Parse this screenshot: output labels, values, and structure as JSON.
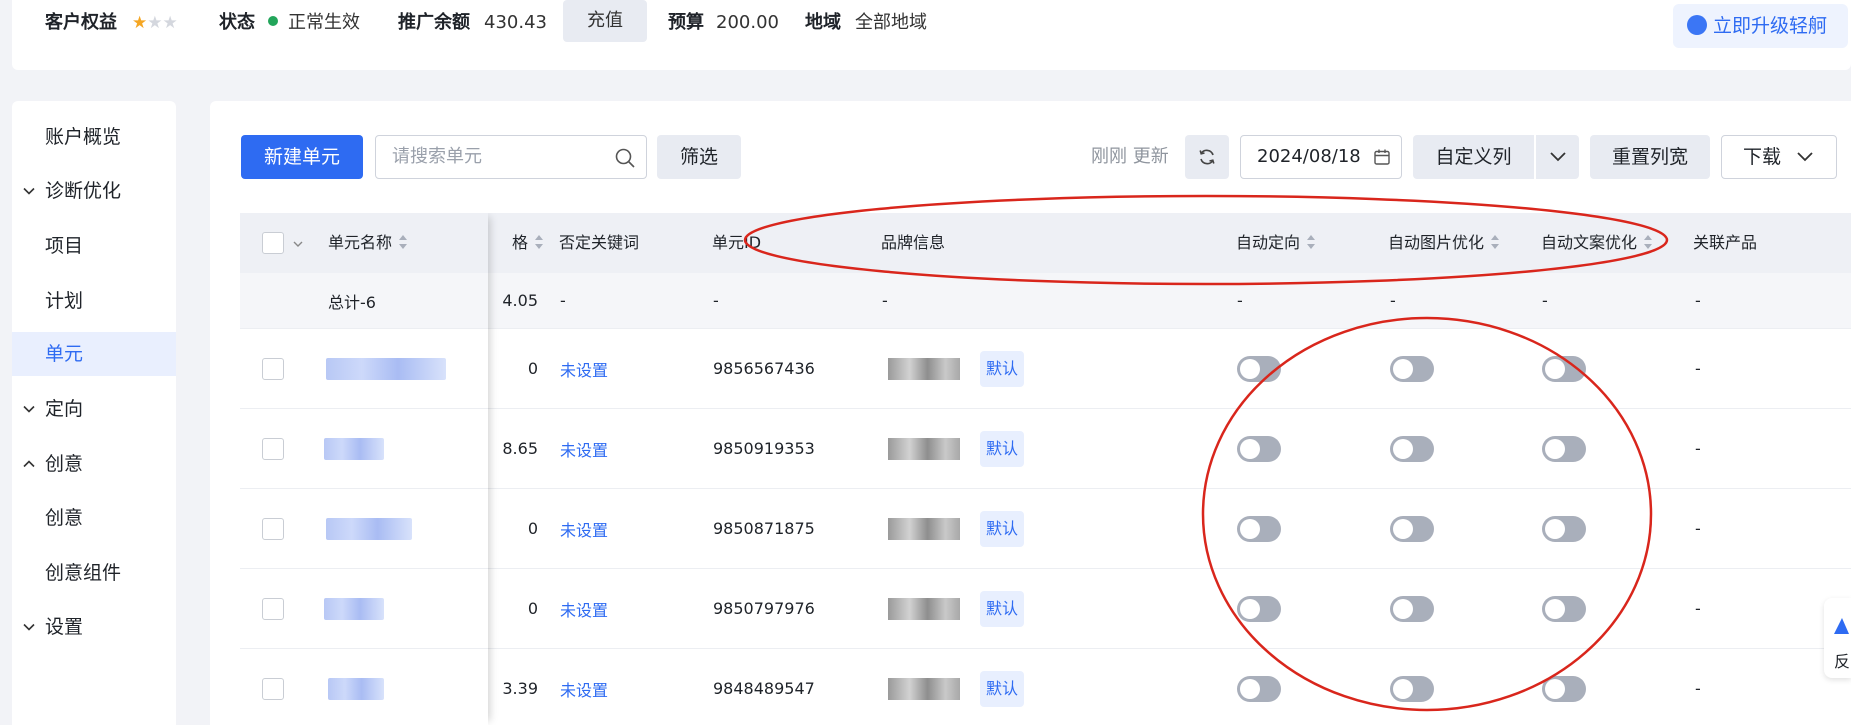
{
  "topbar": {
    "rights_label": "客户权益",
    "rating": {
      "value": 1,
      "max": 3
    },
    "status_label": "状态",
    "status_value": "正常生效",
    "status_color": "#22a55a",
    "balance_label": "推广余额",
    "balance_value": "430.43",
    "recharge_label": "充值",
    "budget_label": "预算",
    "budget_value": "200.00",
    "region_label": "地域",
    "region_value": "全部地域",
    "upgrade_label": "立即升级轻舸"
  },
  "sidebar": {
    "items": [
      {
        "label": "账户概览",
        "chevron": ""
      },
      {
        "label": "诊断优化",
        "chevron": "down"
      },
      {
        "label": "项目",
        "chevron": ""
      },
      {
        "label": "计划",
        "chevron": ""
      },
      {
        "label": "单元",
        "chevron": "",
        "active": true
      },
      {
        "label": "定向",
        "chevron": "down"
      },
      {
        "label": "创意",
        "chevron": "up"
      },
      {
        "label": "创意",
        "chevron": ""
      },
      {
        "label": "创意组件",
        "chevron": ""
      },
      {
        "label": "设置",
        "chevron": "down"
      }
    ]
  },
  "toolbar": {
    "new_unit_label": "新建单元",
    "search_placeholder": "请搜索单元",
    "filter_label": "筛选",
    "updated_text": "刚刚 更新",
    "date_value": "2024/08/18",
    "custom_columns_label": "自定义列",
    "reset_width_label": "重置列宽",
    "download_label": "下载"
  },
  "table": {
    "headers": {
      "name": "单元名称",
      "price": "格",
      "negative_kw": "否定关键词",
      "unit_id": "单元ID",
      "brand": "品牌信息",
      "auto_targeting": "自动定向",
      "auto_image": "自动图片优化",
      "auto_copy": "自动文案优化",
      "related_product": "关联产品"
    },
    "total": {
      "name": "总计-6",
      "price": "4.05",
      "negative_kw": "-",
      "unit_id": "-",
      "brand": "-",
      "auto_targeting": "-",
      "auto_image": "-",
      "auto_copy": "-",
      "related_product": "-"
    },
    "rows": [
      {
        "price": "0",
        "negative_kw": "未设置",
        "unit_id": "9856567436",
        "tag": "默认",
        "related_product": "-",
        "auto_targeting": false,
        "auto_image": false,
        "auto_copy": false
      },
      {
        "price": "8.65",
        "negative_kw": "未设置",
        "unit_id": "9850919353",
        "tag": "默认",
        "related_product": "-",
        "auto_targeting": false,
        "auto_image": false,
        "auto_copy": false
      },
      {
        "price": "0",
        "negative_kw": "未设置",
        "unit_id": "9850871875",
        "tag": "默认",
        "related_product": "-",
        "auto_targeting": false,
        "auto_image": false,
        "auto_copy": false
      },
      {
        "price": "0",
        "negative_kw": "未设置",
        "unit_id": "9850797976",
        "tag": "默认",
        "related_product": "-",
        "auto_targeting": false,
        "auto_image": false,
        "auto_copy": false
      },
      {
        "price": "3.39",
        "negative_kw": "未设置",
        "unit_id": "9848489547",
        "tag": "默认",
        "related_product": "-",
        "auto_targeting": false,
        "auto_image": false,
        "auto_copy": false
      }
    ]
  },
  "feedback": {
    "label": "反"
  },
  "annotation_color": "#d9261c"
}
